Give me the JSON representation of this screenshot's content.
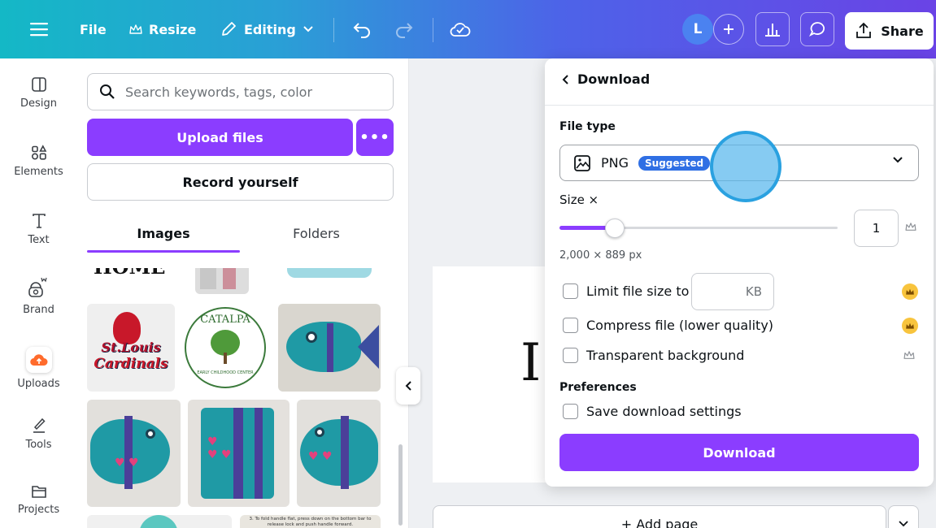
{
  "topbar": {
    "menu_icon": "hamburger-menu-icon",
    "file_label": "File",
    "resize_label": "Resize",
    "editing_label": "Editing",
    "avatar_initial": "L",
    "share_label": "Share",
    "colors": {
      "gradient_start": "#14b8c6",
      "gradient_end": "#6a43e6"
    }
  },
  "leftnav": {
    "items": [
      {
        "label": "Design",
        "icon": "design-icon"
      },
      {
        "label": "Elements",
        "icon": "elements-icon"
      },
      {
        "label": "Text",
        "icon": "text-icon"
      },
      {
        "label": "Brand",
        "icon": "brand-icon"
      },
      {
        "label": "Uploads",
        "icon": "uploads-icon"
      },
      {
        "label": "Tools",
        "icon": "tools-icon"
      },
      {
        "label": "Projects",
        "icon": "folder-icon"
      }
    ]
  },
  "panel": {
    "search_placeholder": "Search keywords, tags, color",
    "upload_label": "Upload files",
    "more_label": "•••",
    "record_label": "Record yourself",
    "tabs": [
      {
        "label": "Images",
        "active": true
      },
      {
        "label": "Folders",
        "active": false
      }
    ],
    "thumb_texts": {
      "home": "HOME",
      "cardinals_line1": "St.Louis",
      "cardinals_line2": "Cardinals",
      "catalpa": "CATALPA",
      "catalpa_sub": "EARLY CHILDHOOD CENTER",
      "instructions": "3. To fold handle flat, press down on the bottom bar to release lock and push handle forward."
    }
  },
  "canvas": {
    "add_page_label": "+ Add page"
  },
  "download": {
    "title": "Download",
    "file_type_label": "File type",
    "file_type_value": "PNG",
    "suggested_badge": "Suggested",
    "size_label": "Size ×",
    "size_value": "1",
    "size_slider_fraction": 0.2,
    "dimensions": "2,000 × 889 px",
    "limit_label": "Limit file size to",
    "kb_unit": "KB",
    "compress_label": "Compress file (lower quality)",
    "transparent_label": "Transparent background",
    "preferences_label": "Preferences",
    "save_settings_label": "Save download settings",
    "download_button": "Download",
    "accent": "#8b3dff"
  }
}
